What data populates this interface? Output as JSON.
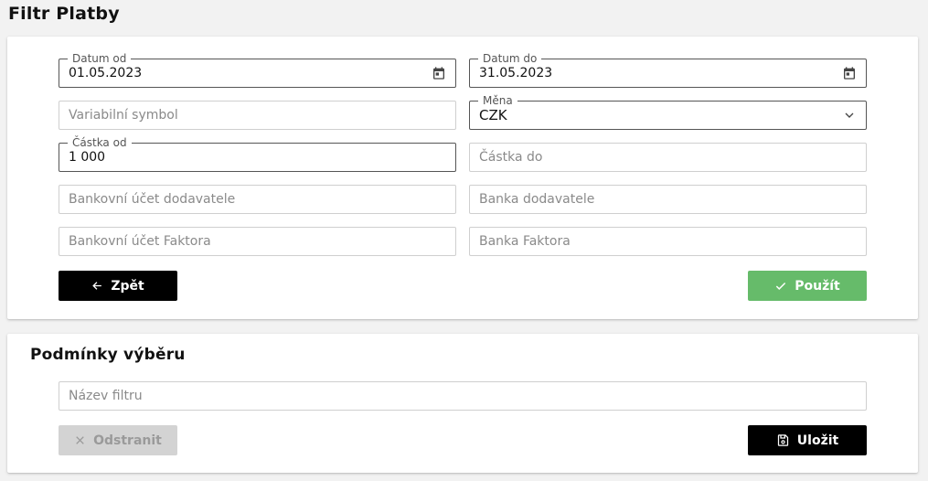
{
  "page": {
    "title": "Filtr Platby"
  },
  "filter": {
    "date_from": {
      "label": "Datum od",
      "value": "01.05.2023",
      "icon": "calendar-icon"
    },
    "date_to": {
      "label": "Datum do",
      "value": "31.05.2023",
      "icon": "calendar-icon"
    },
    "variable_symbol": {
      "placeholder": "Variabilní symbol"
    },
    "currency": {
      "label": "Měna",
      "value": "CZK",
      "icon": "chevron-down-icon"
    },
    "amount_from": {
      "label": "Částka od",
      "value": "1 000"
    },
    "amount_to": {
      "placeholder": "Částka do"
    },
    "supplier_account": {
      "placeholder": "Bankovní účet dodavatele"
    },
    "supplier_bank": {
      "placeholder": "Banka dodavatele"
    },
    "factor_account": {
      "placeholder": "Bankovní účet Faktora"
    },
    "factor_bank": {
      "placeholder": "Banka Faktora"
    },
    "back_label": "Zpět",
    "apply_label": "Použít"
  },
  "conditions": {
    "title": "Podmínky výběru",
    "filter_name": {
      "placeholder": "Název filtru"
    },
    "remove_label": "Odstranit",
    "save_label": "Uložit"
  },
  "colors": {
    "apply_button": "#66bb6a",
    "primary_button": "#000000",
    "disabled_button": "#d3d3d3"
  }
}
